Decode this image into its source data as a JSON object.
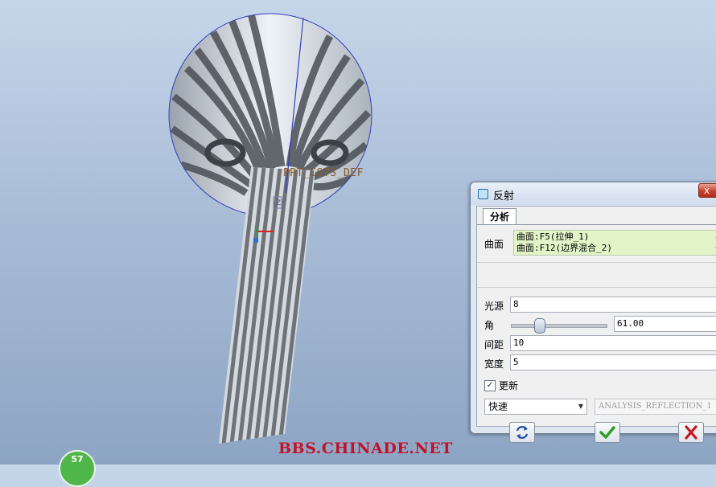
{
  "viewport": {
    "csys_label": "PRT_CSYS_DEF",
    "axis_marker": "Z",
    "watermark": "BBS.CHINADE.NET",
    "badge_count": "57"
  },
  "dialog": {
    "title": "反射",
    "close_symbol": "x",
    "tab_label": "分析",
    "surfaces_label": "曲面",
    "surfaces": [
      "曲面:F5(拉伸_1)",
      "曲面:F12(边界混合_2)"
    ],
    "light_source_label": "光源",
    "light_source_value": "8",
    "angle_label": "角",
    "angle_value": "61.00",
    "angle_slider_fraction": 0.3,
    "spacing_label": "间距",
    "spacing_value": "10",
    "width_label": "宽度",
    "width_value": "5",
    "update_label": "更新",
    "update_checked": true,
    "mode_select": "快速",
    "analysis_name": "ANALYSIS_REFLECTION_1",
    "icons": [
      "dialog-box-icon",
      "refresh-icon",
      "ok-check-icon",
      "cancel-x-icon"
    ]
  },
  "colors": {
    "accent_green": "#2f9d2a",
    "cancel_red": "#c4161c",
    "surface_list_bg": "#e2f5c9",
    "watermark_red": "#c0142a"
  }
}
